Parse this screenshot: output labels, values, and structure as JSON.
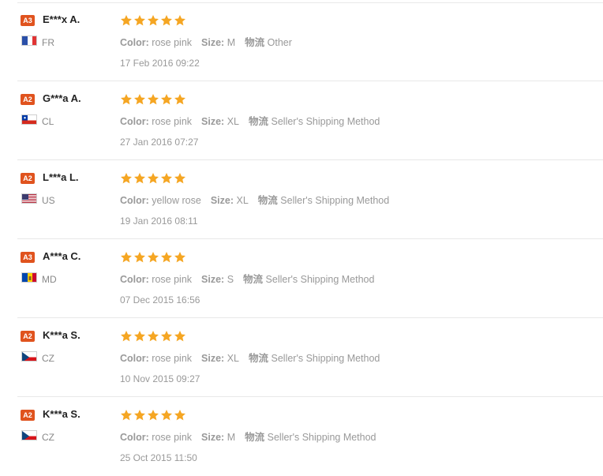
{
  "colors": {
    "badge": "#e0531e",
    "star": "#f5a623",
    "muted": "#999999",
    "name": "#222222"
  },
  "labels": {
    "color": "Color:",
    "size": "Size:",
    "shipping": "物流"
  },
  "reviews": [
    {
      "badge": "A3",
      "name": "E***x A.",
      "country": "FR",
      "flag": "fr-flag-icon",
      "stars": 5,
      "color": "rose pink",
      "size": "M",
      "shipping": "Other",
      "date": "17 Feb 2016 09:22"
    },
    {
      "badge": "A2",
      "name": "G***a A.",
      "country": "CL",
      "flag": "cl-flag-icon",
      "stars": 5,
      "color": "rose pink",
      "size": "XL",
      "shipping": "Seller's Shipping Method",
      "date": "27 Jan 2016 07:27"
    },
    {
      "badge": "A2",
      "name": "L***a L.",
      "country": "US",
      "flag": "us-flag-icon",
      "stars": 5,
      "color": "yellow rose",
      "size": "XL",
      "shipping": "Seller's Shipping Method",
      "date": "19 Jan 2016 08:11"
    },
    {
      "badge": "A3",
      "name": "A***a C.",
      "country": "MD",
      "flag": "md-flag-icon",
      "stars": 5,
      "color": "rose pink",
      "size": "S",
      "shipping": "Seller's Shipping Method",
      "date": "07 Dec 2015 16:56"
    },
    {
      "badge": "A2",
      "name": "K***a S.",
      "country": "CZ",
      "flag": "cz-flag-icon",
      "stars": 5,
      "color": "rose pink",
      "size": "XL",
      "shipping": "Seller's Shipping Method",
      "date": "10 Nov 2015 09:27"
    },
    {
      "badge": "A2",
      "name": "K***a S.",
      "country": "CZ",
      "flag": "cz-flag-icon",
      "stars": 5,
      "color": "rose pink",
      "size": "M",
      "shipping": "Seller's Shipping Method",
      "date": "25 Oct 2015 11:50"
    }
  ]
}
